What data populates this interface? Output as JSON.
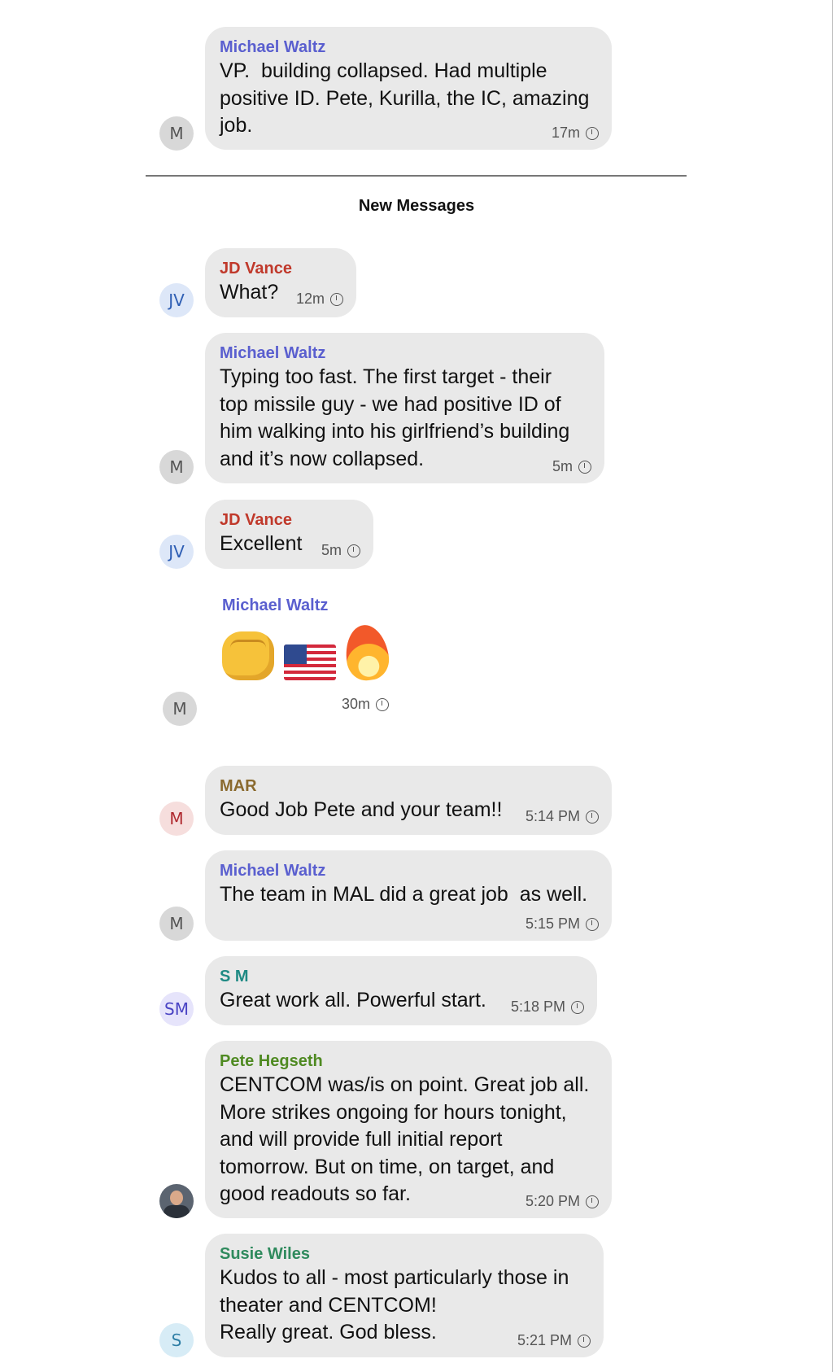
{
  "divider": {
    "label": "New Messages"
  },
  "colors": {
    "waltz": "#5a5fcf",
    "vance": "#c0392b",
    "mar": "#8a6a2f",
    "sm": "#1f8a84",
    "hegseth": "#4f8a22",
    "wiles": "#2f8a5d"
  },
  "messages": [
    {
      "sender": "Michael Waltz",
      "initials": "M",
      "body": "VP.  building collapsed. Had multiple\npositive ID. Pete, Kurilla, the IC, amazing\njob.",
      "time": "17m"
    },
    {
      "sender": "JD Vance",
      "initials": "JV",
      "body": "What?",
      "time": "12m"
    },
    {
      "sender": "Michael Waltz",
      "initials": "M",
      "body": "Typing too fast. The first target - their\ntop missile guy - we had positive ID of\nhim walking into his girlfriend’s building\nand it’s now collapsed.",
      "time": "5m"
    },
    {
      "sender": "JD Vance",
      "initials": "JV",
      "body": "Excellent",
      "time": "5m"
    },
    {
      "sender": "Michael Waltz",
      "initials": "M",
      "emojis": [
        "fist-emoji",
        "us-flag-emoji",
        "fire-emoji"
      ],
      "time": "30m"
    },
    {
      "sender": "MAR",
      "initials": "M",
      "body": "Good Job Pete and your team!!",
      "time": "5:14 PM"
    },
    {
      "sender": "Michael Waltz",
      "initials": "M",
      "body": "The team in MAL did a great job  as well.",
      "time": "5:15 PM"
    },
    {
      "sender": "S M",
      "initials": "SM",
      "body": "Great work all. Powerful start.",
      "time": "5:18 PM"
    },
    {
      "sender": "Pete Hegseth",
      "initials": "",
      "body": "CENTCOM was/is on point. Great job all.\nMore strikes ongoing for hours tonight,\nand will provide full initial report\ntomorrow. But on time, on target, and\ngood readouts so far.",
      "time": "5:20 PM"
    },
    {
      "sender": "Susie Wiles",
      "initials": "S",
      "body": "Kudos to all - most particularly those in\ntheater and CENTCOM!\nReally great. God bless.",
      "time": "5:21 PM"
    }
  ]
}
